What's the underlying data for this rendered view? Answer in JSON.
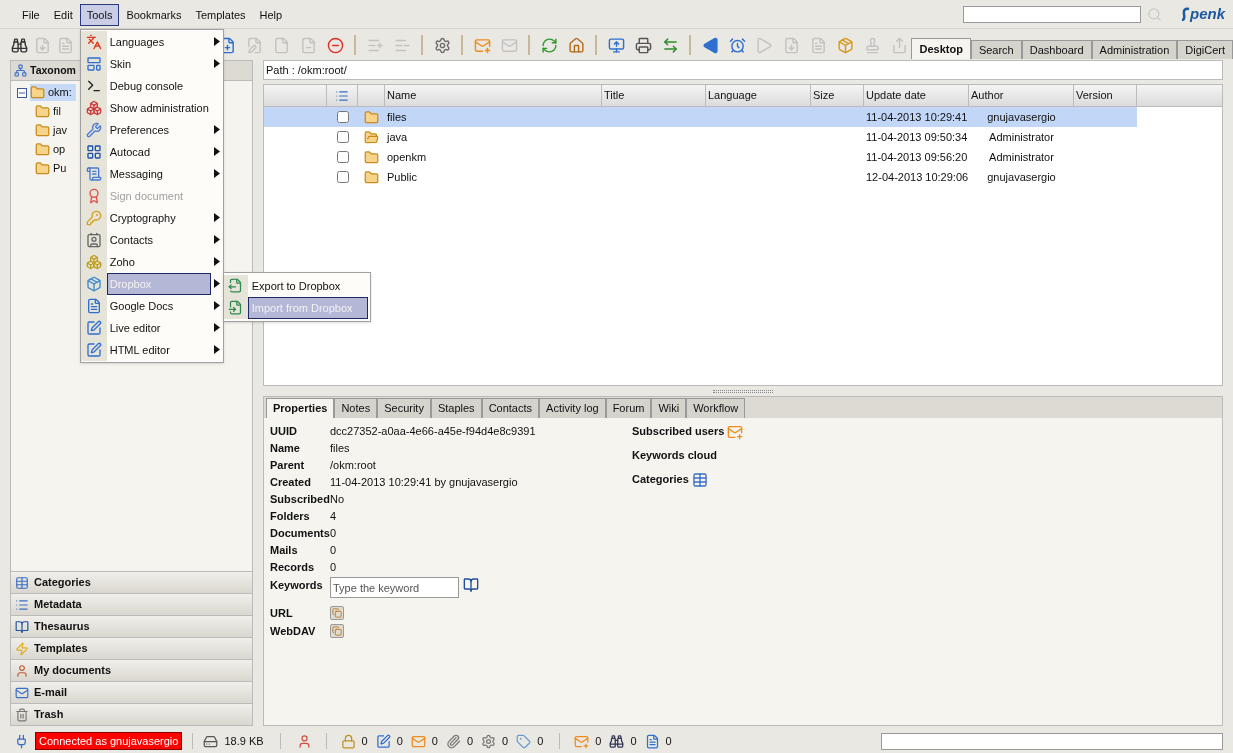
{
  "menu_bar": [
    {
      "label": "File",
      "selected": false
    },
    {
      "label": "Edit",
      "selected": false
    },
    {
      "label": "Tools",
      "selected": true
    },
    {
      "label": "Bookmarks",
      "selected": false
    },
    {
      "label": "Templates",
      "selected": false
    },
    {
      "label": "Help",
      "selected": false
    }
  ],
  "logo": "penk",
  "toolbar_left": [
    {
      "disabled": false
    },
    {
      "disabled": true
    },
    {
      "disabled": true
    }
  ],
  "toolbar": [
    {
      "kind": "button",
      "disabled": false
    },
    {
      "kind": "button",
      "disabled": true
    },
    {
      "kind": "button",
      "disabled": true
    },
    {
      "kind": "button",
      "disabled": true
    },
    {
      "kind": "button",
      "disabled": false
    },
    {
      "kind": "separator"
    },
    {
      "kind": "button",
      "disabled": true
    },
    {
      "kind": "button",
      "disabled": true
    },
    {
      "kind": "separator"
    },
    {
      "kind": "button",
      "disabled": false
    },
    {
      "kind": "separator"
    },
    {
      "kind": "button",
      "disabled": false
    },
    {
      "kind": "button",
      "disabled": true
    },
    {
      "kind": "separator"
    },
    {
      "kind": "button",
      "disabled": false
    },
    {
      "kind": "button",
      "disabled": false
    },
    {
      "kind": "separator"
    },
    {
      "kind": "button",
      "disabled": false
    },
    {
      "kind": "button",
      "disabled": false
    },
    {
      "kind": "button",
      "disabled": false
    },
    {
      "kind": "separator"
    },
    {
      "kind": "button",
      "disabled": false
    },
    {
      "kind": "button",
      "disabled": false
    },
    {
      "kind": "button",
      "disabled": true
    },
    {
      "kind": "button",
      "disabled": true
    },
    {
      "kind": "button",
      "disabled": true
    },
    {
      "kind": "button",
      "disabled": false
    },
    {
      "kind": "button",
      "disabled": true
    },
    {
      "kind": "button",
      "disabled": true
    }
  ],
  "view_tabs": [
    {
      "label": "Desktop",
      "selected": true
    },
    {
      "label": "Search",
      "selected": false
    },
    {
      "label": "Dashboard",
      "selected": false
    },
    {
      "label": "Administration",
      "selected": false
    },
    {
      "label": "DigiCert",
      "selected": false
    }
  ],
  "tools_menu": [
    {
      "label": "Languages",
      "has_submenu": true,
      "disabled": false,
      "highlighted": false
    },
    {
      "label": "Skin",
      "has_submenu": true,
      "disabled": false,
      "highlighted": false
    },
    {
      "label": "Debug console",
      "has_submenu": false,
      "disabled": false,
      "highlighted": false
    },
    {
      "label": "Show administration",
      "has_submenu": false,
      "disabled": false,
      "highlighted": false
    },
    {
      "label": "Preferences",
      "has_submenu": true,
      "disabled": false,
      "highlighted": false
    },
    {
      "label": "Autocad",
      "has_submenu": true,
      "disabled": false,
      "highlighted": false
    },
    {
      "label": "Messaging",
      "has_submenu": true,
      "disabled": false,
      "highlighted": false
    },
    {
      "label": "Sign document",
      "has_submenu": false,
      "disabled": true,
      "highlighted": false
    },
    {
      "label": "Cryptography",
      "has_submenu": true,
      "disabled": false,
      "highlighted": false
    },
    {
      "label": "Contacts",
      "has_submenu": true,
      "disabled": false,
      "highlighted": false
    },
    {
      "label": "Zoho",
      "has_submenu": true,
      "disabled": false,
      "highlighted": false
    },
    {
      "label": "Dropbox",
      "has_submenu": true,
      "disabled": false,
      "highlighted": true
    },
    {
      "label": "Google Docs",
      "has_submenu": true,
      "disabled": false,
      "highlighted": false
    },
    {
      "label": "Live editor",
      "has_submenu": true,
      "disabled": false,
      "highlighted": false
    },
    {
      "label": "HTML editor",
      "has_submenu": true,
      "disabled": false,
      "highlighted": false
    }
  ],
  "dropbox_submenu": [
    {
      "label": "Export to Dropbox",
      "highlighted": false
    },
    {
      "label": "Import from Dropbox",
      "highlighted": true
    }
  ],
  "left_panel": {
    "title": "Taxonom",
    "tree": [
      {
        "label": "okm:",
        "expanded": true,
        "selected": true,
        "children": [
          {
            "label": "fil",
            "selected": false
          },
          {
            "label": "jav",
            "selected": false
          },
          {
            "label": "op",
            "selected": false
          },
          {
            "label": "Pu",
            "selected": false
          }
        ]
      }
    ],
    "sections": [
      "Categories",
      "Metadata",
      "Thesaurus",
      "Templates",
      "My documents",
      "E-mail",
      "Trash"
    ]
  },
  "path": "Path : /okm:root/",
  "file_table": {
    "columns": [
      "Name",
      "Title",
      "Language",
      "Size",
      "Update date",
      "Author",
      "Version"
    ],
    "rows": [
      {
        "name": "files",
        "update_date": "11-04-2013 10:29:41",
        "author": "gnujavasergio",
        "selected": true,
        "checked": false
      },
      {
        "name": "java",
        "update_date": "11-04-2013 09:50:34",
        "author": "Administrator",
        "selected": false,
        "checked": false
      },
      {
        "name": "openkm",
        "update_date": "11-04-2013 09:56:20",
        "author": "Administrator",
        "selected": false,
        "checked": false
      },
      {
        "name": "Public",
        "update_date": "12-04-2013 10:29:06",
        "author": "gnujavasergio",
        "selected": false,
        "checked": false
      }
    ]
  },
  "detail_tabs": [
    {
      "label": "Properties",
      "selected": true
    },
    {
      "label": "Notes",
      "selected": false
    },
    {
      "label": "Security",
      "selected": false
    },
    {
      "label": "Staples",
      "selected": false
    },
    {
      "label": "Contacts",
      "selected": false
    },
    {
      "label": "Activity log",
      "selected": false
    },
    {
      "label": "Forum",
      "selected": false
    },
    {
      "label": "Wiki",
      "selected": false
    },
    {
      "label": "Workflow",
      "selected": false
    }
  ],
  "properties": [
    {
      "label": "UUID",
      "value": "dcc27352-a0aa-4e66-a45e-f94d4e8c9391"
    },
    {
      "label": "Name",
      "value": "files"
    },
    {
      "label": "Parent",
      "value": "/okm:root"
    },
    {
      "label": "Created",
      "value": "11-04-2013 10:29:41 by gnujavasergio"
    },
    {
      "label": "Subscribed",
      "value": "No"
    },
    {
      "label": "Folders",
      "value": "4"
    },
    {
      "label": "Documents",
      "value": "0"
    },
    {
      "label": "Mails",
      "value": "0"
    },
    {
      "label": "Records",
      "value": "0"
    }
  ],
  "keywords": {
    "label": "Keywords",
    "placeholder": "Type the keyword"
  },
  "links": [
    "URL",
    "WebDAV"
  ],
  "side_props": [
    "Subscribed users",
    "Keywords cloud",
    "Categories"
  ],
  "status_bar": {
    "connection": "Connected as gnujavasergio",
    "size": "18.9 KB",
    "counters": [
      "0",
      "0",
      "0",
      "0",
      "0",
      "0"
    ],
    "counters_2": [
      "0",
      "0",
      "0"
    ]
  }
}
